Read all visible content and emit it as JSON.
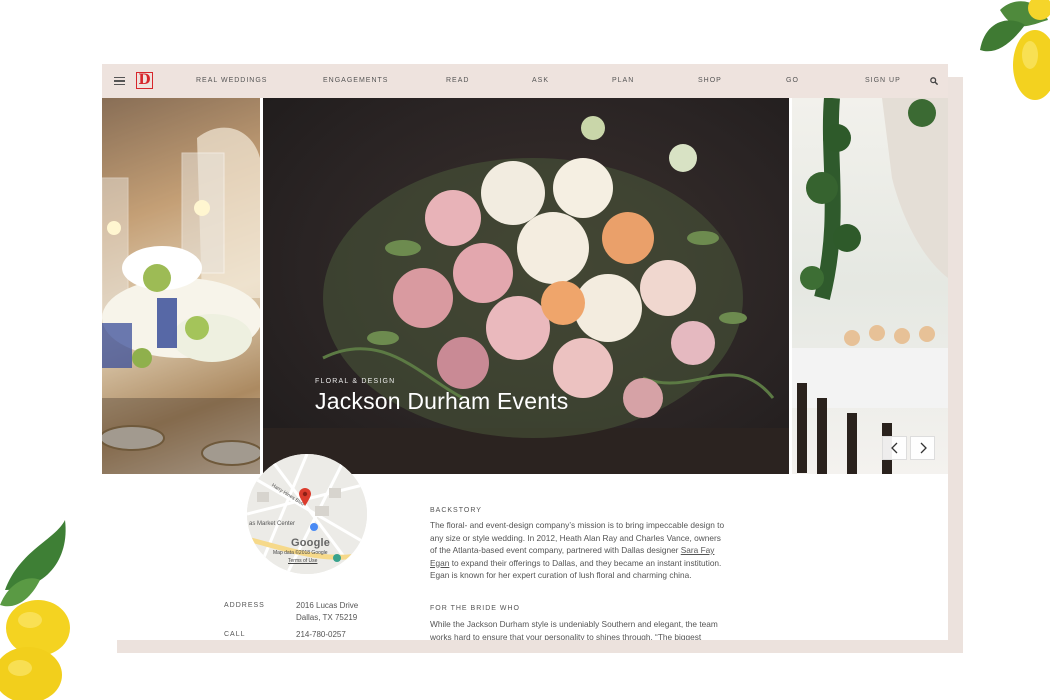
{
  "nav": {
    "logo": "D",
    "items": [
      "REAL WEDDINGS",
      "ENGAGEMENTS",
      "READ",
      "ASK",
      "PLAN",
      "SHOP",
      "GO",
      "SIGN UP"
    ]
  },
  "gallery": {
    "category": "FLORAL & DESIGN",
    "title": "Jackson Durham Events",
    "prev_label": "<",
    "next_label": ">"
  },
  "map": {
    "place": "as Market Center",
    "street": "Harry Hines Blvd",
    "brand": "Google",
    "copyright": "Map data ©2018 Google",
    "terms": "Terms of Use"
  },
  "contact": {
    "address_label": "ADDRESS",
    "address_line1": "2016 Lucas Drive",
    "address_line2": "Dallas, TX 75219",
    "call_label": "CALL",
    "phone": "214-780-0257"
  },
  "article": {
    "backstory_heading": "BACKSTORY",
    "backstory_before_link": "The floral- and event-design company’s mission is to bring impeccable design to any size or style wedding. In 2012, Heath Alan Ray and Charles Vance, owners of the Atlanta-based event company, partnered with Dallas designer ",
    "backstory_link": "Sara Fay Egan",
    "backstory_after_link": " to expand their offerings to Dallas, and they became an instant institution. Egan is known for her expert curation of lush floral and charming china.",
    "bride_heading": "FOR THE BRIDE WHO",
    "bride_body": "While the Jackson Durham style is undeniably Southern and elegant, the team works hard to ensure that your personality to shines through. “The biggest"
  },
  "colors": {
    "nav_bg": "#eee3de",
    "frame_shadow": "#ece2dd",
    "logo_red": "#d7262b",
    "text": "#555555"
  },
  "icons": [
    "menu-icon",
    "search-icon",
    "map-pin-icon",
    "chevron-left-icon",
    "chevron-right-icon",
    "lemon-icon"
  ]
}
